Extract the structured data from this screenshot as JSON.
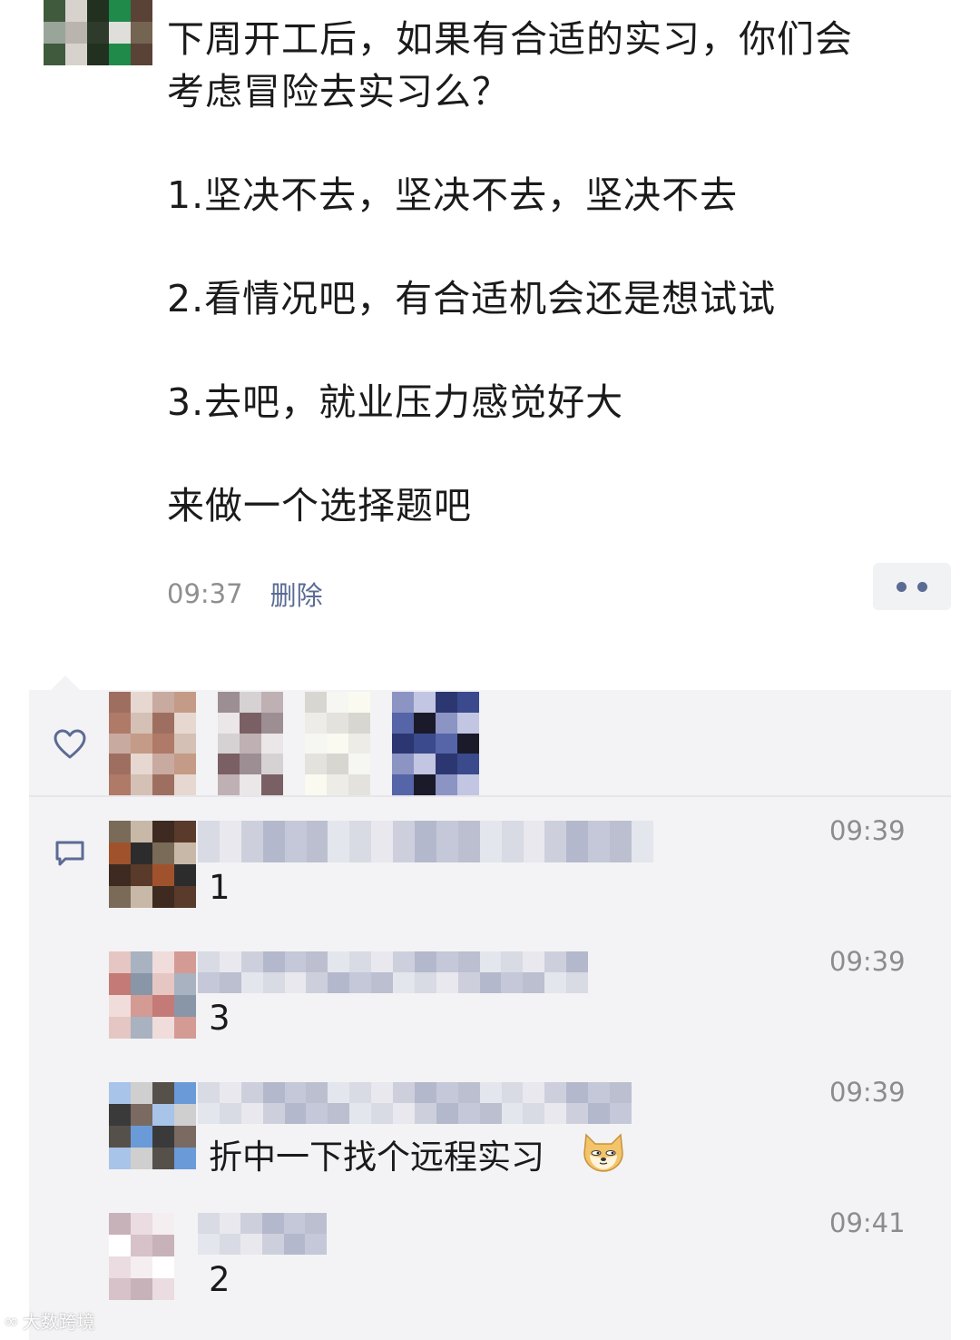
{
  "post": {
    "lines": [
      "下周开工后，如果有合适的实习，你们会",
      "考虑冒险去实习么？",
      "",
      "1.坚决不去，坚决不去，坚决不去",
      "",
      "2.看情况吧，有合适机会还是想试试",
      "",
      "3.去吧，就业压力感觉好大",
      "",
      "来做一个选择题吧"
    ],
    "time": "09:37",
    "delete_label": "删除"
  },
  "icons": {
    "like": "heart-icon",
    "comment": "comment-icon",
    "more": "more-dots-icon",
    "emoji": "doge-emoji-icon"
  },
  "comments": [
    {
      "text": "1",
      "time": "09:39"
    },
    {
      "text": "3",
      "time": "09:39"
    },
    {
      "text": "折中一下找个远程实习",
      "time": "09:39"
    },
    {
      "text": "2",
      "time": "09:41"
    }
  ],
  "watermark": "大数跨境",
  "colors": {
    "link": "#5b6b94",
    "panel_bg": "#f3f3f5",
    "meta_text": "#8f8f8f"
  }
}
